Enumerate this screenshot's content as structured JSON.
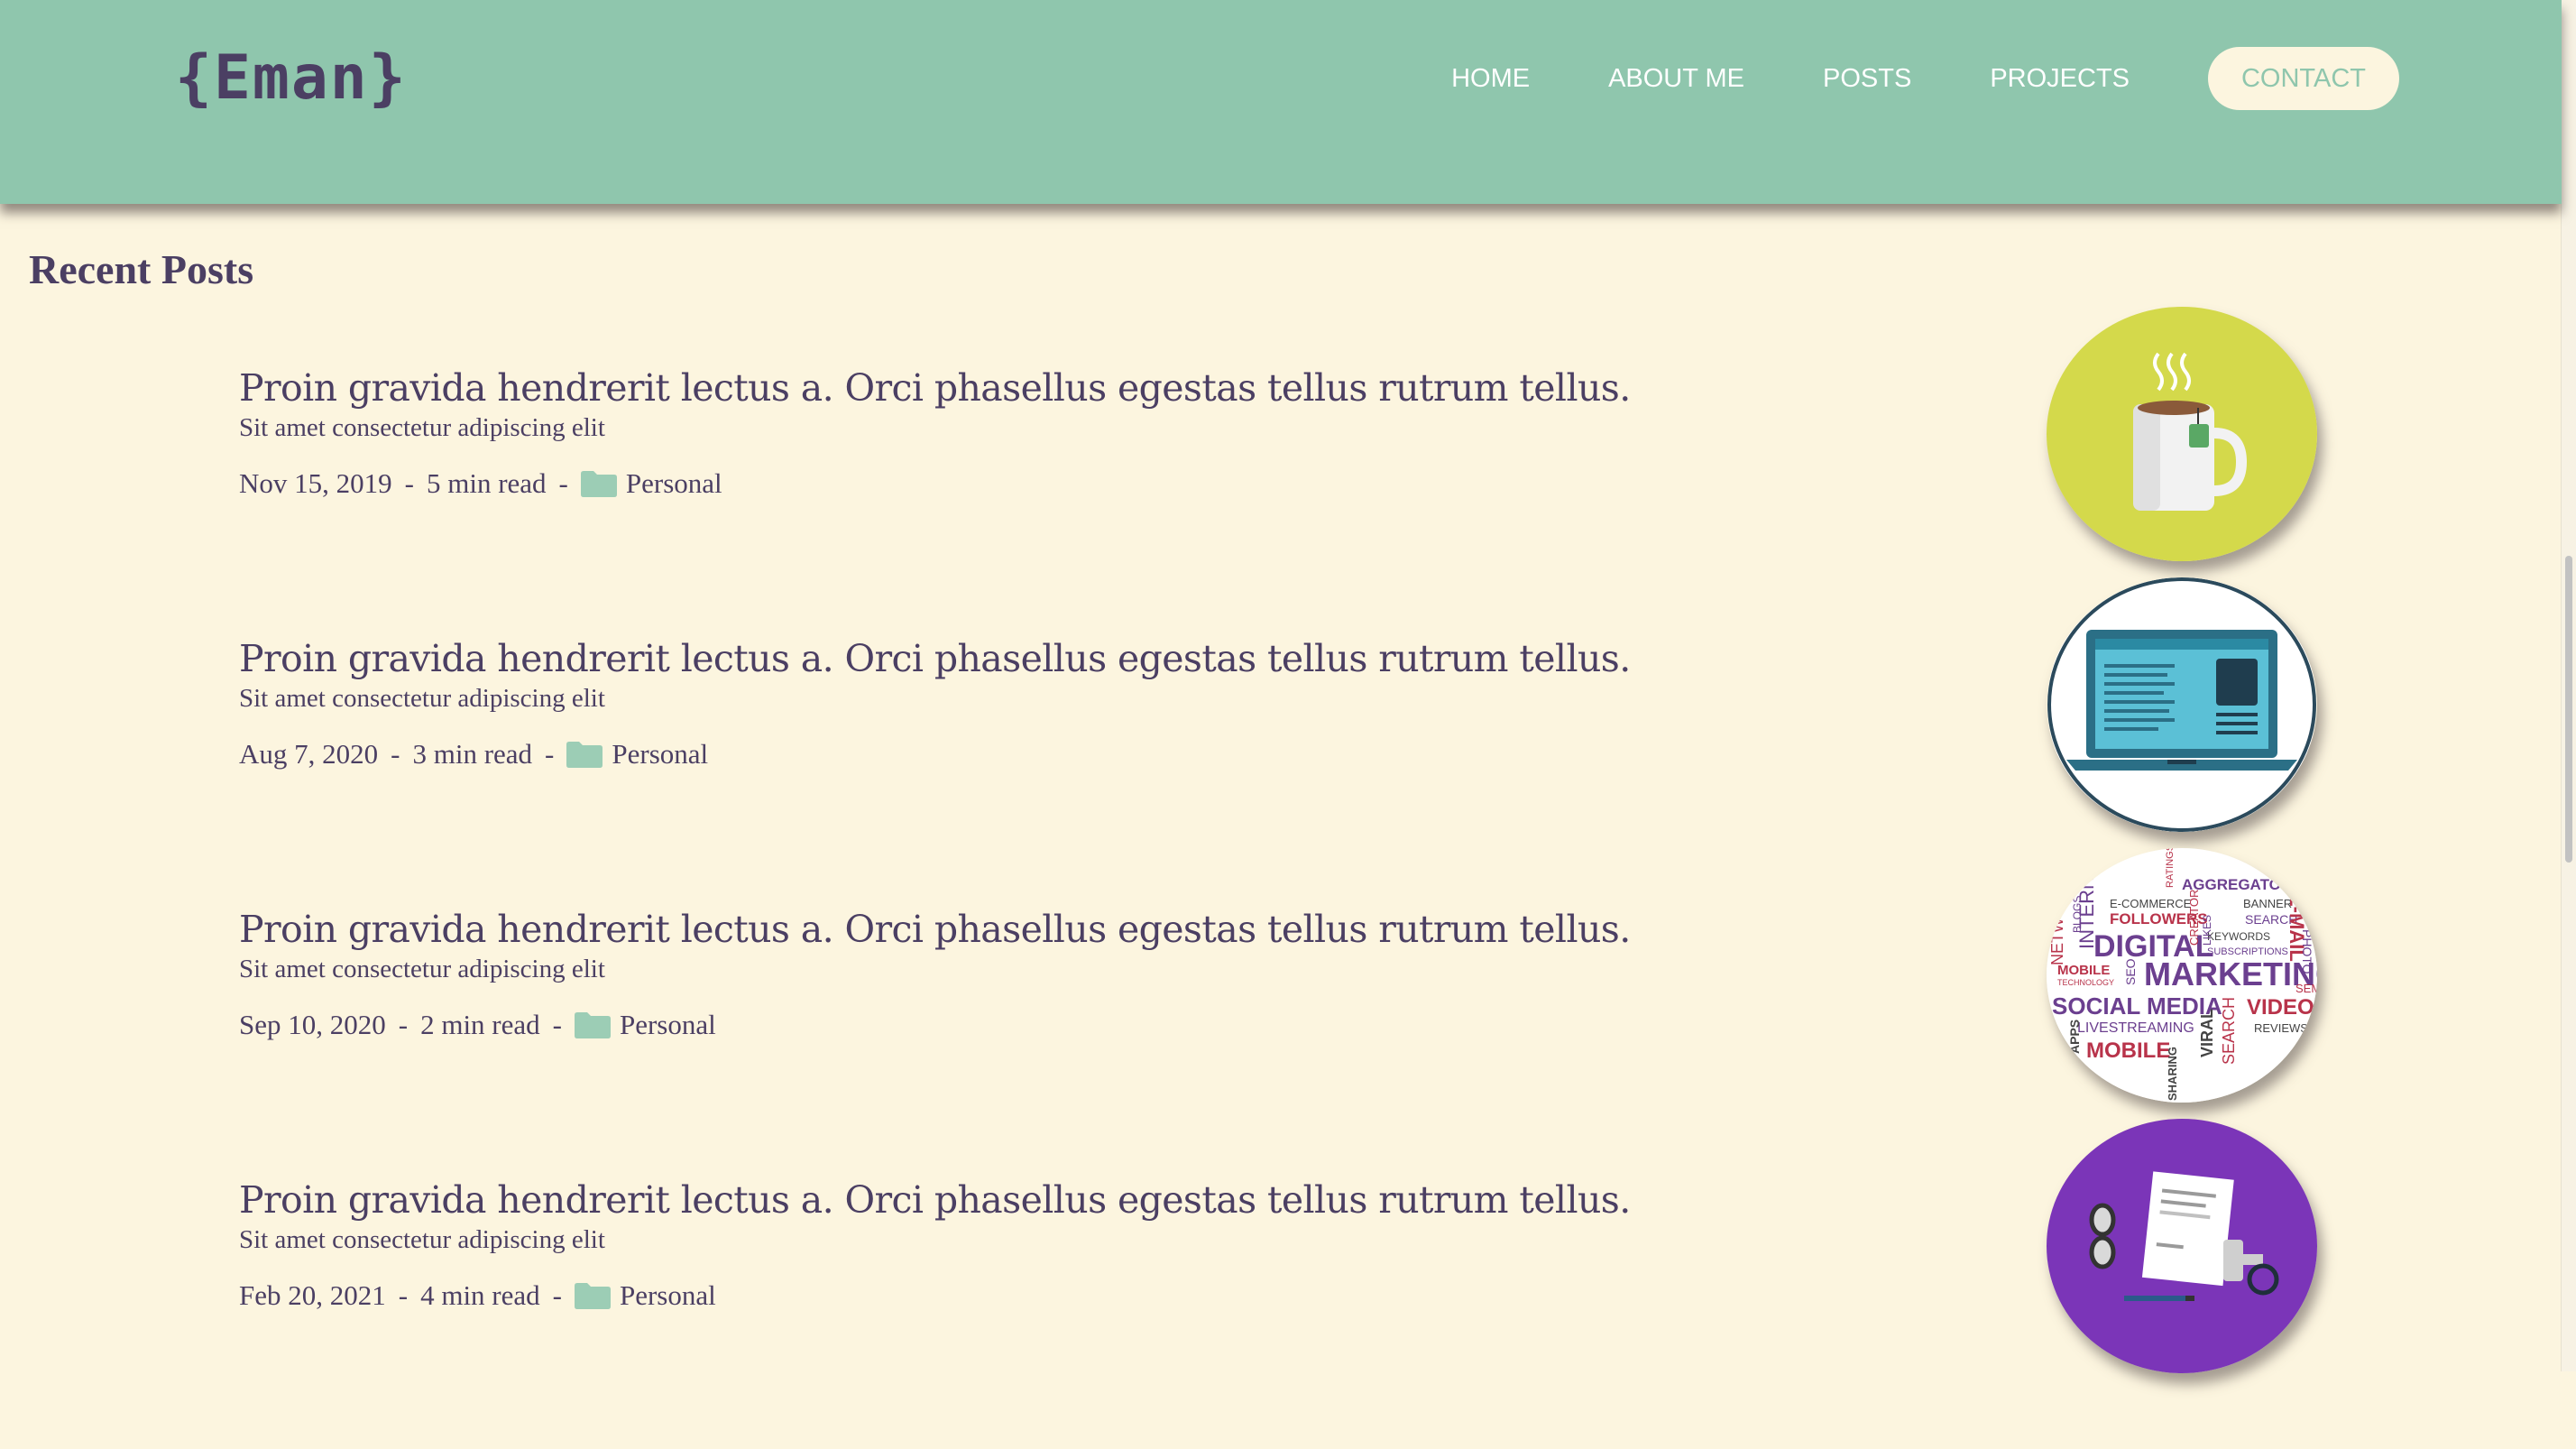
{
  "header": {
    "logo": "{Eman}",
    "nav": [
      "HOME",
      "ABOUT ME",
      "POSTS",
      "PROJECTS"
    ],
    "contact": "CONTACT"
  },
  "section": {
    "title": "Recent Posts"
  },
  "posts": [
    {
      "title": "Proin gravida hendrerit lectus a. Orci phasellus egestas tellus rutrum tellus.",
      "subtitle": "Sit amet consectetur adipiscing elit",
      "date": "Nov 15, 2019",
      "read": "5 min read",
      "category": "Personal",
      "thumb": "tea-cup"
    },
    {
      "title": "Proin gravida hendrerit lectus a. Orci phasellus egestas tellus rutrum tellus.",
      "subtitle": "Sit amet consectetur adipiscing elit",
      "date": "Aug 7, 2020",
      "read": "3 min read",
      "category": "Personal",
      "thumb": "laptop"
    },
    {
      "title": "Proin gravida hendrerit lectus a. Orci phasellus egestas tellus rutrum tellus.",
      "subtitle": "Sit amet consectetur adipiscing elit",
      "date": "Sep 10, 2020",
      "read": "2 min read",
      "category": "Personal",
      "thumb": "word-cloud",
      "cloud_words": [
        "AGGREGATORS",
        "E-COMMERCE",
        "BANNER",
        "BLOGS",
        "FOLLOWERS",
        "SEARCH",
        "DIGITAL",
        "KEYWORDS",
        "SUBSCRIPTIONS",
        "MOBILE",
        "TECHNOLOGY",
        "MARKETING",
        "SOCIAL MEDIA",
        "VIDEOS",
        "LIVESTREAMING",
        "REVIEWS",
        "MOBILE",
        "VIRAL",
        "SEARCH",
        "SHARING",
        "NETWORK",
        "INTERNET",
        "E-MAIL",
        "PHOTO",
        "RATINGS",
        "CREATOR",
        "LIKES",
        "SEO",
        "APPS",
        "SEM"
      ]
    },
    {
      "title": "Proin gravida hendrerit lectus a. Orci phasellus egestas tellus rutrum tellus.",
      "subtitle": "Sit amet consectetur adipiscing elit",
      "date": "Feb 20, 2021",
      "read": "4 min read",
      "category": "Personal",
      "thumb": "documents"
    }
  ],
  "colors": {
    "header": "#8fc6ad",
    "background": "#fcf5df",
    "text": "#4b3f63",
    "folder": "#9ccdb5"
  }
}
